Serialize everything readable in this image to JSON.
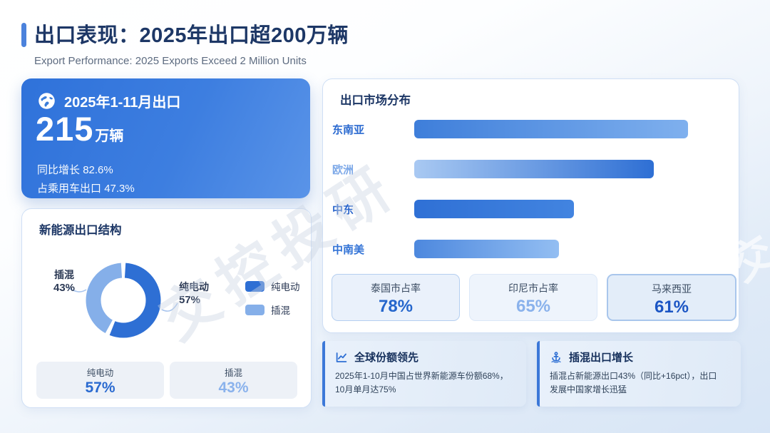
{
  "page": {
    "title": "出口表现：2025年出口超200万辆",
    "subtitle": "Export Performance: 2025 Exports Exceed 2 Million Units",
    "watermark": "交控投研"
  },
  "colors": {
    "accent": "#4b82dc",
    "dark_blue": "#2e6fd4",
    "light_blue": "#85afe9",
    "title_navy": "#1d3766"
  },
  "export_summary": {
    "icon": "globe-icon",
    "period": "2025年1-11月出口",
    "value": "215",
    "unit": "万辆",
    "growth_label": "同比增长",
    "growth_value": "82.6%",
    "share_label": "占乘用车出口",
    "share_value": "47.3%"
  },
  "nev_structure": {
    "title": "新能源出口结构",
    "callout_left": {
      "label": "插混",
      "value": "43%"
    },
    "callout_right": {
      "label": "纯电动",
      "value": "57%"
    },
    "legend": [
      {
        "label": "纯电动",
        "color": "#2e6fd4"
      },
      {
        "label": "插混",
        "color": "#85afe9"
      }
    ],
    "stats": [
      {
        "label": "纯电动",
        "value": "57%",
        "value_color": "#2a6ad0"
      },
      {
        "label": "插混",
        "value": "43%",
        "value_color": "#8ab2ec"
      }
    ]
  },
  "market_distribution": {
    "title": "出口市场分布",
    "bars": [
      {
        "label": "东南亚",
        "label_color": "#2b6ad0",
        "width_pct": 89,
        "gradient_from": "#3e7eda",
        "gradient_to": "#7fb0ee"
      },
      {
        "label": "欧洲",
        "label_color": "#7ea9e8",
        "width_pct": 78,
        "gradient_from": "#a9c9f2",
        "gradient_to": "#2e6fd4"
      },
      {
        "label": "中东",
        "label_color": "#2b66cc",
        "width_pct": 52,
        "gradient_from": "#2f70d5",
        "gradient_to": "#4284e0"
      },
      {
        "label": "中南美",
        "label_color": "#3273d6",
        "width_pct": 47,
        "gradient_from": "#4d88de",
        "gradient_to": "#93bef2"
      }
    ],
    "stats": [
      {
        "label": "泰国市占率",
        "value": "78%",
        "value_color": "#2566cc"
      },
      {
        "label": "印尼市占率",
        "value": "65%",
        "value_color": "#8ab2ec"
      },
      {
        "label": "马来西亚",
        "value": "61%",
        "value_color": "#1b55c4"
      }
    ]
  },
  "highlights": [
    {
      "icon": "line-chart-icon",
      "title": "全球份额领先",
      "text": "2025年1-10月中国占世界新能源车份额68%，\n10月单月达75%"
    },
    {
      "icon": "anchor-icon",
      "title": "插混出口增长",
      "text": "插混占新能源出口43%（同比+16pct），出口\n发展中国家增长迅猛"
    }
  ],
  "chart_data": [
    {
      "type": "pie",
      "subtype": "donut",
      "title": "新能源出口结构",
      "labels": [
        "纯电动",
        "插混"
      ],
      "values": [
        57,
        43
      ],
      "unit": "%",
      "colors": [
        "#2e6fd4",
        "#85afe9"
      ],
      "legend_position": "right",
      "data_labels": [
        "纯电动 57%",
        "插混 43%"
      ]
    },
    {
      "type": "bar",
      "orientation": "horizontal",
      "title": "出口市场分布",
      "categories": [
        "东南亚",
        "欧洲",
        "中东",
        "中南美"
      ],
      "values": [
        89,
        78,
        52,
        47
      ],
      "value_note": "relative bar lengths as % of plot width; no numeric labels shown",
      "grid": false,
      "legend": false
    }
  ]
}
